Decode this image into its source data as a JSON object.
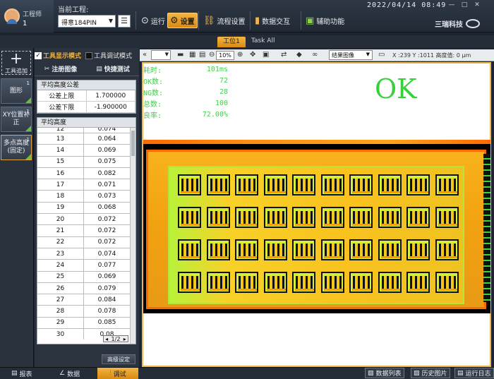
{
  "user": {
    "role": "工程师",
    "id": "1"
  },
  "project": {
    "label": "当前工程:",
    "value": "得意184PIN"
  },
  "toolbar": {
    "run": "运行",
    "settings": "设置",
    "flow": "流程设置",
    "data": "数据交互",
    "aux": "辅助功能"
  },
  "datetime": "2022/04/14  08:49",
  "brand": "三瑞科技",
  "tabs": {
    "station": "工位1",
    "task_all": "Task All"
  },
  "tools": {
    "add": "工具追加",
    "items": [
      {
        "name": "图形",
        "index": "1"
      },
      {
        "name": "XY位置补正",
        "index": "1"
      },
      {
        "name": "多点高度(固定)",
        "index": "1"
      }
    ]
  },
  "modes": {
    "tool_display": "工具显示模式",
    "tool_debug": "工具调试模式"
  },
  "actions": {
    "register": "注册图像",
    "quick_test": "快捷测试"
  },
  "tolerance": {
    "title": "平均高度公差",
    "rows": [
      {
        "label": "公差上限",
        "value": "1.700000"
      },
      {
        "label": "公差下限",
        "value": "-1.900000"
      }
    ]
  },
  "avg": {
    "title": "平均高度",
    "rows": [
      {
        "idx": "12",
        "val": "0.074"
      },
      {
        "idx": "13",
        "val": "0.064"
      },
      {
        "idx": "14",
        "val": "0.069"
      },
      {
        "idx": "15",
        "val": "0.075"
      },
      {
        "idx": "16",
        "val": "0.082"
      },
      {
        "idx": "17",
        "val": "0.071"
      },
      {
        "idx": "18",
        "val": "0.073"
      },
      {
        "idx": "19",
        "val": "0.068"
      },
      {
        "idx": "20",
        "val": "0.072"
      },
      {
        "idx": "21",
        "val": "0.072"
      },
      {
        "idx": "22",
        "val": "0.072"
      },
      {
        "idx": "23",
        "val": "0.074"
      },
      {
        "idx": "24",
        "val": "0.077"
      },
      {
        "idx": "25",
        "val": "0.069"
      },
      {
        "idx": "26",
        "val": "0.079"
      },
      {
        "idx": "27",
        "val": "0.084"
      },
      {
        "idx": "28",
        "val": "0.078"
      },
      {
        "idx": "29",
        "val": "0.085"
      },
      {
        "idx": "30",
        "val": "0.08"
      }
    ],
    "pager": "1/2"
  },
  "advanced_button": "高级设定",
  "viewer": {
    "zoom": "10%",
    "result_select": "结果图像",
    "coords": "X :239 Y :1011 高度值: 0 µm"
  },
  "stats": [
    {
      "label": "耗时:",
      "value": "101ms"
    },
    {
      "label": "OK数:",
      "value": "72"
    },
    {
      "label": "NG数:",
      "value": "28"
    },
    {
      "label": "总数:",
      "value": "100"
    },
    {
      "label": "良率:",
      "value": "72.00%"
    }
  ],
  "result": "OK",
  "bottom_tabs": {
    "report": "报表",
    "data": "数据",
    "debug": "调试"
  },
  "bottom_buttons": {
    "data_list": "数据列表",
    "history": "历史图片",
    "run_log": "运行日志"
  },
  "colors": {
    "accent": "#e9a020",
    "ok_green": "#36d13a",
    "panel_bg": "#2b333e"
  }
}
